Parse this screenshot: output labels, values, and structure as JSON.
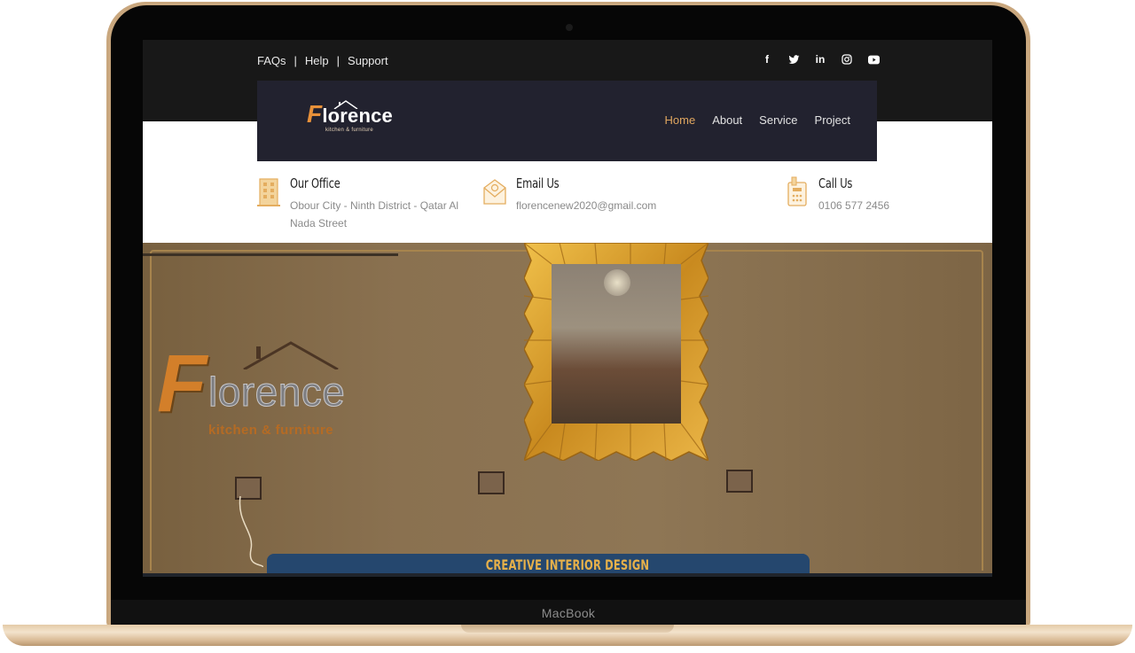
{
  "device": {
    "brand_label": "MacBook"
  },
  "topbar": {
    "links": [
      {
        "label": "FAQs"
      },
      {
        "label": "Help"
      },
      {
        "label": "Support"
      }
    ],
    "separator": "|",
    "social": [
      {
        "icon": "facebook-icon",
        "glyph": "f"
      },
      {
        "icon": "twitter-icon",
        "glyph": "t"
      },
      {
        "icon": "linkedin-icon",
        "glyph": "in"
      },
      {
        "icon": "instagram-icon",
        "glyph": "◎"
      },
      {
        "icon": "youtube-icon",
        "glyph": "▶"
      }
    ]
  },
  "brand": {
    "initial": "F",
    "name": "lorence",
    "tagline": "kitchen & furniture"
  },
  "nav": {
    "items": [
      {
        "label": "Home",
        "active": true
      },
      {
        "label": "About",
        "active": false
      },
      {
        "label": "Service",
        "active": false
      },
      {
        "label": "Project",
        "active": false
      }
    ]
  },
  "info": {
    "office": {
      "title": "Our Office",
      "line1": "Obour City - Ninth District - Qatar Al",
      "line2": "Nada Street",
      "icon": "building-icon"
    },
    "email": {
      "title": "Email Us",
      "value": "florencenew2020@gmail.com",
      "icon": "envelope-icon"
    },
    "phone": {
      "title": "Call Us",
      "value": "0106 577 2456",
      "icon": "phone-icon"
    }
  },
  "hero": {
    "logo_initial": "F",
    "logo_word": "lorence",
    "logo_sub": "kitchen & furniture",
    "title": "CREATIVE INTERIOR DESIGN"
  },
  "colors": {
    "accent": "#e0a65f",
    "nav_bg": "#22222f",
    "topbar_bg": "#181818",
    "laptop_gold": "#c9a77e"
  }
}
